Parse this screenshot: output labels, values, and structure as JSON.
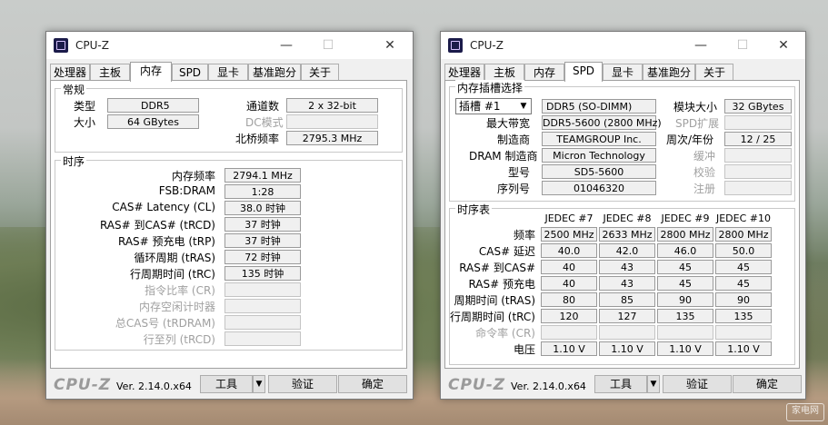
{
  "win1": {
    "title": "CPU-Z",
    "tabs": [
      "处理器",
      "主板",
      "内存",
      "SPD",
      "显卡",
      "基准跑分",
      "关于"
    ],
    "general": {
      "title": "常规",
      "type_label": "类型",
      "type_value": "DDR5",
      "size_label": "大小",
      "size_value": "64 GBytes",
      "channels_label": "通道数",
      "channels_value": "2 x 32-bit",
      "dc_label": "DC模式",
      "dc_value": "",
      "nb_label": "北桥频率",
      "nb_value": "2795.3 MHz"
    },
    "timing": {
      "title": "时序",
      "rows": [
        {
          "label": "内存频率",
          "value": "2794.1 MHz",
          "enabled": true
        },
        {
          "label": "FSB:DRAM",
          "value": "1:28",
          "enabled": true
        },
        {
          "label": "CAS# Latency (CL)",
          "value": "38.0 时钟",
          "enabled": true
        },
        {
          "label": "RAS# 到CAS# (tRCD)",
          "value": "37 时钟",
          "enabled": true
        },
        {
          "label": "RAS# 预充电 (tRP)",
          "value": "37 时钟",
          "enabled": true
        },
        {
          "label": "循环周期 (tRAS)",
          "value": "72 时钟",
          "enabled": true
        },
        {
          "label": "行周期时间 (tRC)",
          "value": "135 时钟",
          "enabled": true
        },
        {
          "label": "指令比率 (CR)",
          "value": "",
          "enabled": false
        },
        {
          "label": "内存空闲计时器",
          "value": "",
          "enabled": false
        },
        {
          "label": "总CAS号 (tRDRAM)",
          "value": "",
          "enabled": false
        },
        {
          "label": "行至列 (tRCD)",
          "value": "",
          "enabled": false
        }
      ]
    },
    "logo": "CPU-Z",
    "version": "Ver. 2.14.0.x64",
    "tools_label": "工具",
    "validate_label": "验证",
    "ok_label": "确定"
  },
  "win2": {
    "title": "CPU-Z",
    "tabs": [
      "处理器",
      "主板",
      "内存",
      "SPD",
      "显卡",
      "基准跑分",
      "关于"
    ],
    "slot": {
      "title": "内存插槽选择",
      "selected": "插槽 #1",
      "module_type": "DDR5 (SO-DIMM)",
      "module_size_label": "模块大小",
      "module_size_value": "32 GBytes",
      "max_bw_label": "最大带宽",
      "max_bw_value": "DDR5-5600 (2800 MHz)",
      "spd_ext_label": "SPD扩展",
      "spd_ext_value": "",
      "mfr_label": "制造商",
      "mfr_value": "TEAMGROUP Inc.",
      "week_label": "周次/年份",
      "week_value": "12 / 25",
      "dram_mfr_label": "DRAM 制造商",
      "dram_mfr_value": "Micron Technology",
      "buffer_label": "缓冲",
      "buffer_value": "",
      "model_label": "型号",
      "model_value": "SD5-5600",
      "check_label": "校验",
      "check_value": "",
      "serial_label": "序列号",
      "serial_value": "01046320",
      "reg_label": "注册",
      "reg_value": ""
    },
    "timing_table": {
      "title": "时序表",
      "columns": [
        "JEDEC #7",
        "JEDEC #8",
        "JEDEC #9",
        "JEDEC #10"
      ],
      "rows": [
        {
          "label": "频率",
          "values": [
            "2500 MHz",
            "2633 MHz",
            "2800 MHz",
            "2800 MHz"
          ],
          "enabled": true
        },
        {
          "label": "CAS# 延迟",
          "values": [
            "40.0",
            "42.0",
            "46.0",
            "50.0"
          ],
          "enabled": true
        },
        {
          "label": "RAS# 到CAS#",
          "values": [
            "40",
            "43",
            "45",
            "45"
          ],
          "enabled": true
        },
        {
          "label": "RAS# 预充电",
          "values": [
            "40",
            "43",
            "45",
            "45"
          ],
          "enabled": true
        },
        {
          "label": "周期时间 (tRAS)",
          "values": [
            "80",
            "85",
            "90",
            "90"
          ],
          "enabled": true
        },
        {
          "label": "行周期时间 (tRC)",
          "values": [
            "120",
            "127",
            "135",
            "135"
          ],
          "enabled": true
        },
        {
          "label": "命令率 (CR)",
          "values": [
            "",
            "",
            "",
            ""
          ],
          "enabled": false
        },
        {
          "label": "电压",
          "values": [
            "1.10 V",
            "1.10 V",
            "1.10 V",
            "1.10 V"
          ],
          "enabled": true
        }
      ]
    },
    "logo": "CPU-Z",
    "version": "Ver. 2.14.0.x64",
    "tools_label": "工具",
    "validate_label": "验证",
    "ok_label": "确定"
  },
  "watermark": "家电网"
}
